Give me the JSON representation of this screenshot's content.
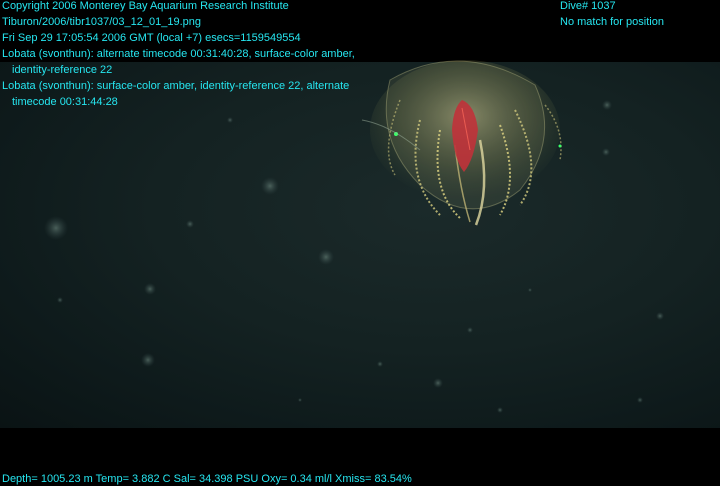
{
  "overlay": {
    "lines": [
      "Copyright 2006 Monterey Bay Aquarium Research Institute",
      "Tiburon/2006/tibr1037/03_12_01_19.png",
      "Fri Sep 29 17:05:54 2006 GMT (local +7)  esecs=1159549554",
      "Lobata (svonthun): alternate timecode 00:31:40:28, surface-color amber,",
      "identity-reference 22",
      "Lobata (svonthun): surface-color amber, identity-reference 22, alternate",
      "timecode 00:31:44:28"
    ],
    "dive": "Dive# 1037",
    "position": "No match for position",
    "telemetry": "Depth= 1005.23 m  Temp= 3.882 C  Sal= 34.398 PSU  Oxy= 0.34 ml/l  Xmiss= 83.54%"
  },
  "colors": {
    "text": "#26e6f0",
    "water": "#142222",
    "organism_core": "#c0323a",
    "organism_lobes": "#c9c27a"
  }
}
